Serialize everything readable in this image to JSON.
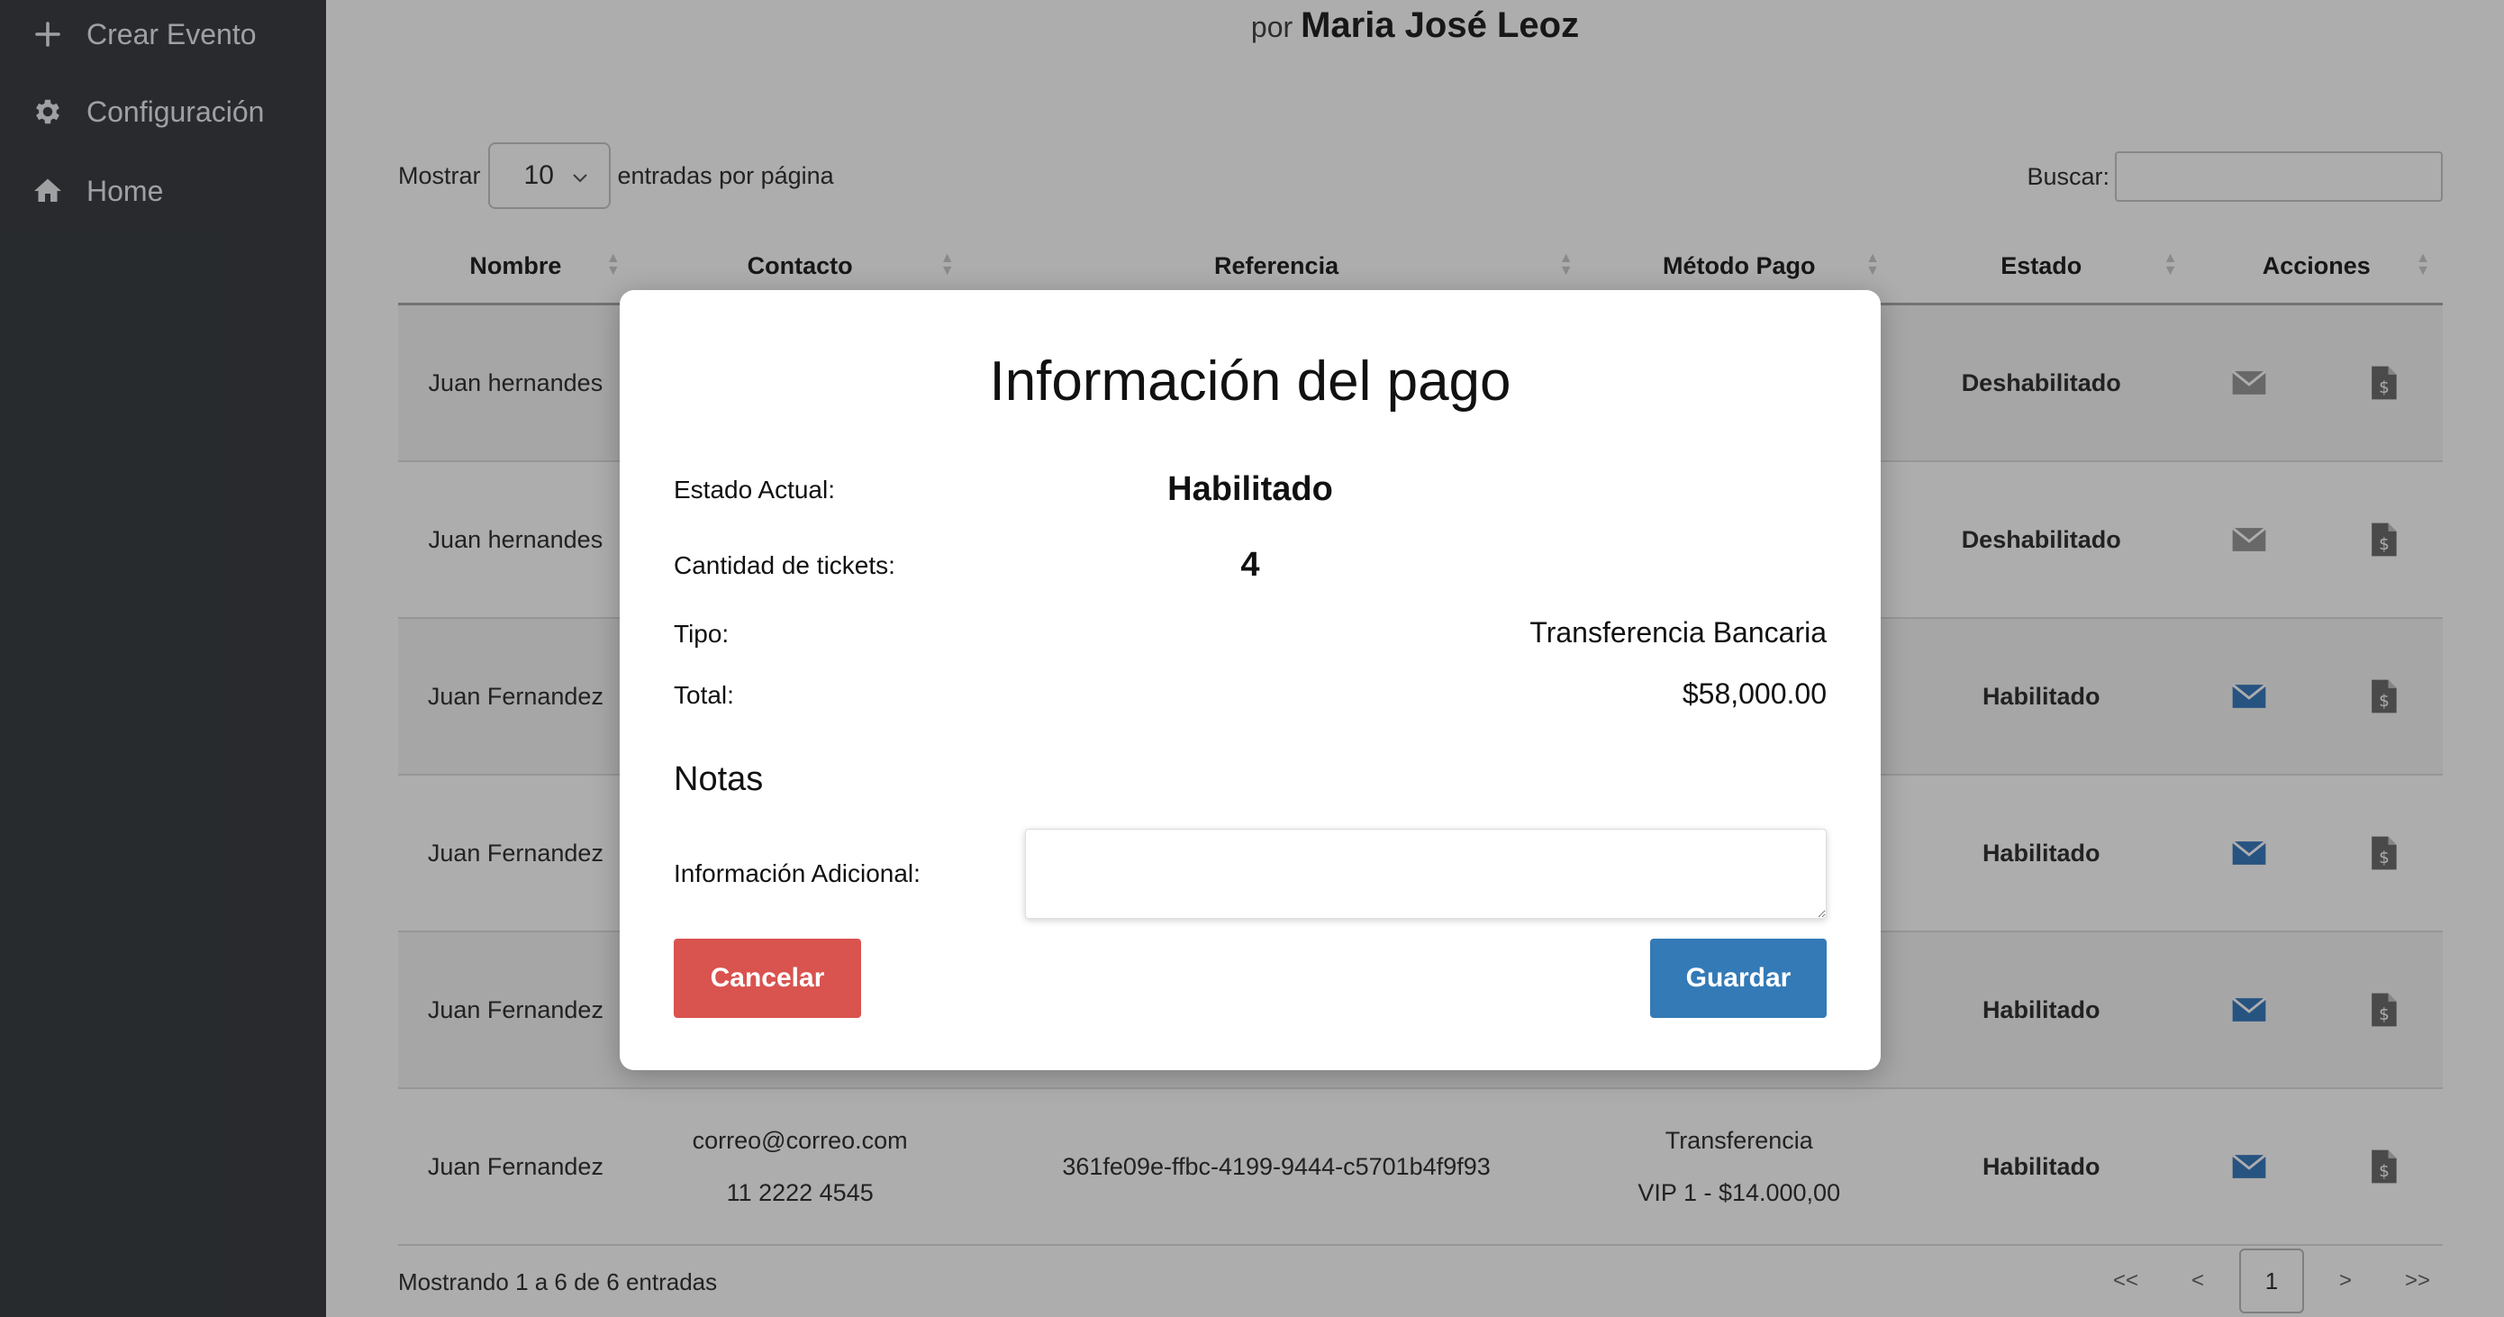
{
  "sidebar": {
    "items": [
      {
        "label": "Crear Evento",
        "icon": "plus-icon"
      },
      {
        "label": "Configuración",
        "icon": "gear-icon"
      },
      {
        "label": "Home",
        "icon": "home-icon"
      }
    ]
  },
  "header": {
    "prefix": "por",
    "organizer": "Maria José Leoz"
  },
  "controls": {
    "show_label": "Mostrar",
    "page_size": "10",
    "entries_label": "entradas por página",
    "search_label": "Buscar:",
    "search_value": ""
  },
  "table": {
    "columns": [
      "Nombre",
      "Contacto",
      "Referencia",
      "Método Pago",
      "Estado",
      "Acciones"
    ],
    "rows": [
      {
        "name": "Juan hernandes",
        "status": "Deshabilitado",
        "enabled": false
      },
      {
        "name": "Juan hernandes",
        "status": "Deshabilitado",
        "enabled": false
      },
      {
        "name": "Juan Fernandez",
        "status": "Habilitado",
        "enabled": true
      },
      {
        "name": "Juan Fernandez",
        "status": "Habilitado",
        "enabled": true
      },
      {
        "name": "Juan Fernandez",
        "status": "Habilitado",
        "enabled": true
      },
      {
        "name": "Juan Fernandez",
        "email": "correo@correo.com",
        "phone": "11 2222 4545",
        "reference": "361fe09e-ffbc-4199-9444-c5701b4f9f93",
        "method": "Transferencia",
        "ticket": "VIP 1 - $14.000,00",
        "status": "Habilitado",
        "enabled": true
      }
    ]
  },
  "footer": {
    "info": "Mostrando 1 a 6 de 6 entradas",
    "pager": {
      "first": "<<",
      "prev": "<",
      "current": "1",
      "next": ">",
      "last": ">>"
    }
  },
  "modal": {
    "title": "Información del pago",
    "estado_label": "Estado Actual:",
    "estado_value": "Habilitado",
    "tickets_label": "Cantidad de tickets:",
    "tickets_value": "4",
    "tipo_label": "Tipo:",
    "tipo_value": "Transferencia Bancaria",
    "total_label": "Total:",
    "total_value": "$58,000.00",
    "notes_title": "Notas",
    "notes_label": "Información Adicional:",
    "notes_value": "",
    "cancel_label": "Cancelar",
    "save_label": "Guardar"
  },
  "colors": {
    "sidebar_bg": "#3b3f44",
    "status_disabled": "#d9534f",
    "status_enabled": "#3e8e41",
    "primary": "#337ab7",
    "danger": "#d9534f",
    "mail_enabled": "#3a7bbf",
    "mail_disabled": "#9a9a9a"
  }
}
